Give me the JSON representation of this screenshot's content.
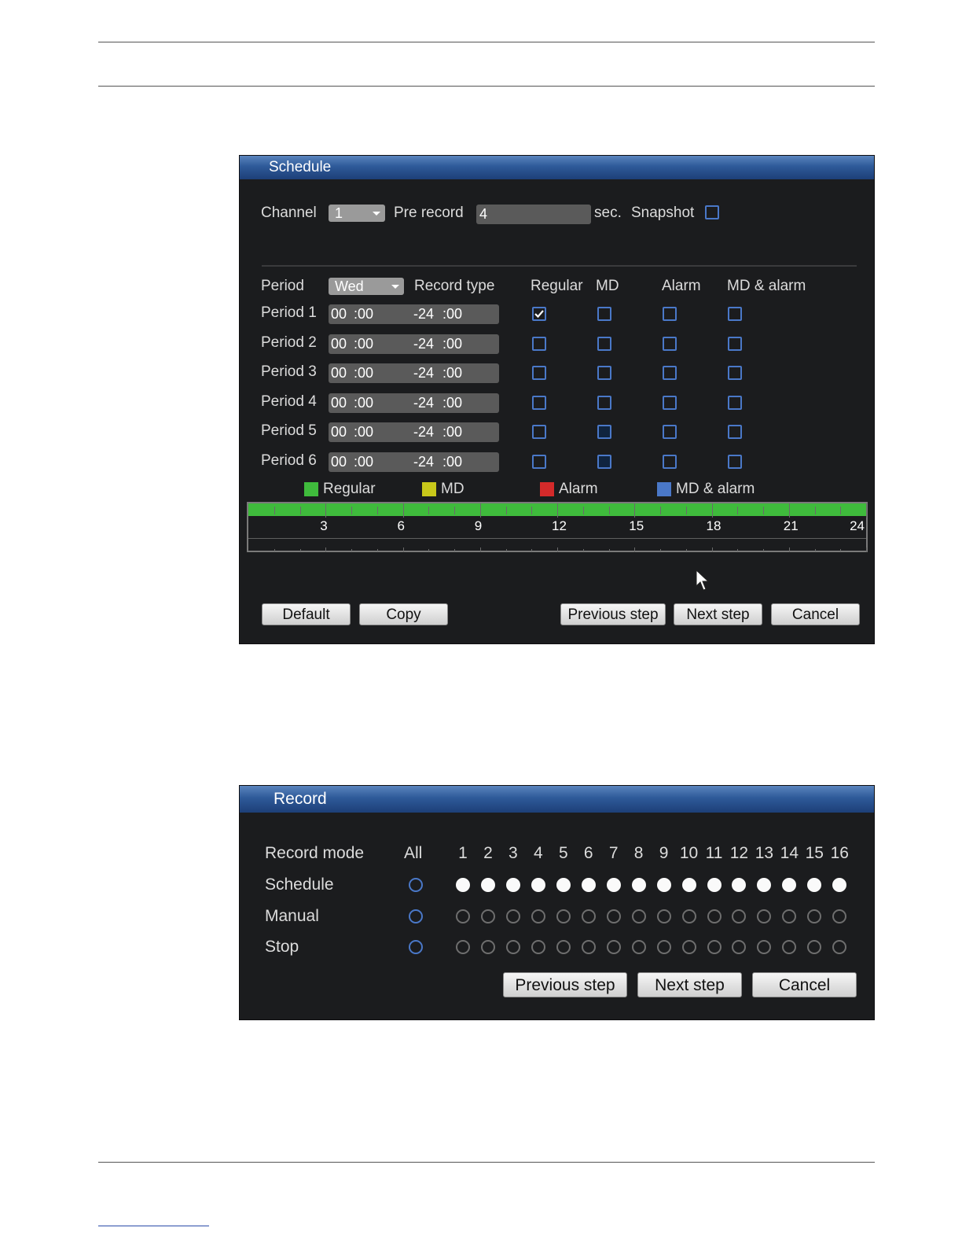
{
  "schedule": {
    "title": "Schedule",
    "channel_label": "Channel",
    "channel_value": "1",
    "prerecord_label": "Pre record",
    "prerecord_value": "4",
    "sec_label": "sec.",
    "snapshot_label": "Snapshot",
    "snapshot_checked": false,
    "period_label": "Period",
    "day_value": "Wed",
    "record_type_label": "Record type",
    "types": [
      "Regular",
      "MD",
      "Alarm",
      "MD & alarm"
    ],
    "periods": [
      {
        "label": "Period 1",
        "start_h": "00",
        "start_m": ":00",
        "end_h": "-24",
        "end_m": ":00",
        "checks": [
          true,
          false,
          false,
          false
        ]
      },
      {
        "label": "Period 2",
        "start_h": "00",
        "start_m": ":00",
        "end_h": "-24",
        "end_m": ":00",
        "checks": [
          false,
          false,
          false,
          false
        ]
      },
      {
        "label": "Period 3",
        "start_h": "00",
        "start_m": ":00",
        "end_h": "-24",
        "end_m": ":00",
        "checks": [
          false,
          false,
          false,
          false
        ]
      },
      {
        "label": "Period 4",
        "start_h": "00",
        "start_m": ":00",
        "end_h": "-24",
        "end_m": ":00",
        "checks": [
          false,
          false,
          false,
          false
        ]
      },
      {
        "label": "Period 5",
        "start_h": "00",
        "start_m": ":00",
        "end_h": "-24",
        "end_m": ":00",
        "checks": [
          false,
          false,
          false,
          false
        ]
      },
      {
        "label": "Period 6",
        "start_h": "00",
        "start_m": ":00",
        "end_h": "-24",
        "end_m": ":00",
        "checks": [
          false,
          false,
          false,
          false
        ]
      }
    ],
    "legend": [
      {
        "label": "Regular",
        "color": "#3fbb3c"
      },
      {
        "label": "MD",
        "color": "#c8c81a"
      },
      {
        "label": "Alarm",
        "color": "#d42a2a"
      },
      {
        "label": "MD & alarm",
        "color": "#4a78c8"
      }
    ],
    "timeline": {
      "hours": [
        "3",
        "6",
        "9",
        "12",
        "15",
        "18",
        "21",
        "24"
      ],
      "regular_from": 0,
      "regular_to": 24,
      "color": "#3fbb3c"
    },
    "buttons": {
      "default": "Default",
      "copy": "Copy",
      "previous": "Previous step",
      "next": "Next step",
      "cancel": "Cancel"
    }
  },
  "record": {
    "title": "Record",
    "mode_label": "Record mode",
    "all_label": "All",
    "channels": [
      "1",
      "2",
      "3",
      "4",
      "5",
      "6",
      "7",
      "8",
      "9",
      "10",
      "11",
      "12",
      "13",
      "14",
      "15",
      "16"
    ],
    "rows": [
      {
        "label": "Schedule",
        "all_selected": false,
        "selected": [
          true,
          true,
          true,
          true,
          true,
          true,
          true,
          true,
          true,
          true,
          true,
          true,
          true,
          true,
          true,
          true
        ]
      },
      {
        "label": "Manual",
        "all_selected": false,
        "selected": [
          false,
          false,
          false,
          false,
          false,
          false,
          false,
          false,
          false,
          false,
          false,
          false,
          false,
          false,
          false,
          false
        ]
      },
      {
        "label": "Stop",
        "all_selected": false,
        "selected": [
          false,
          false,
          false,
          false,
          false,
          false,
          false,
          false,
          false,
          false,
          false,
          false,
          false,
          false,
          false,
          false
        ]
      }
    ],
    "buttons": {
      "previous": "Previous step",
      "next": "Next step",
      "cancel": "Cancel"
    }
  },
  "colors": {
    "accent": "#2e5a99",
    "checkbox_border": "#4a78c8",
    "dialog_bg": "#1b1c1e"
  }
}
